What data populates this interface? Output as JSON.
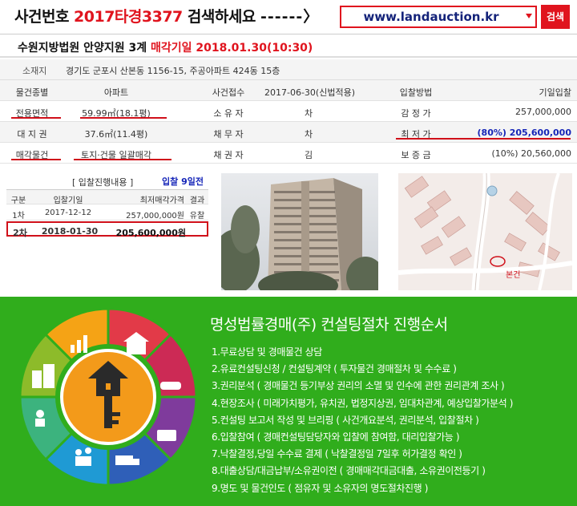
{
  "header": {
    "case_label": "사건번호",
    "case_number": "2017타경3377",
    "search_prompt": "검색하세요",
    "arrow": "------〉",
    "site_select": "www.landauction.kr",
    "search_button": "검색"
  },
  "court": {
    "info": "수원지방법원  안양지원  3계",
    "sale_date": "매각기일 2018.01.30(10:30)"
  },
  "address": {
    "label": "소재지",
    "value": "경기도 군포시 산본동 1156-15, 주공아파트 424동 15층"
  },
  "info_rows": [
    [
      "물건종별",
      "아파트",
      "사건접수",
      "2017-06-30(신법적용)",
      "입찰방법",
      "기일입찰"
    ],
    [
      "전용면적",
      "59.99㎡(18.1평)",
      "소 유 자",
      "차",
      "감 정 가",
      "257,000,000"
    ],
    [
      "대 지 권",
      "37.6㎡(11.4평)",
      "채 무 자",
      "차",
      "최 저 가",
      "(80%) 205,600,000"
    ],
    [
      "매각물건",
      "토지·건물 일괄매각",
      "채 권 자",
      "김",
      "보 증 금",
      "(10%) 20,560,000"
    ]
  ],
  "bid_history": {
    "title": "[ 입찰진행내용 ]",
    "days": "입찰 9일전",
    "headers": [
      "구분",
      "입찰기일",
      "최저매각가격",
      "결과"
    ],
    "rows": [
      [
        "1차",
        "2017-12-12",
        "257,000,000원",
        "유찰"
      ],
      [
        "2차",
        "2018-01-30",
        "205,600,000원",
        ""
      ]
    ]
  },
  "map": {
    "label": "본건"
  },
  "process": {
    "title": "명성법률경매(주) 컨설팅절차 진행순서",
    "steps": [
      "1.무료상담 및 경매물건 상담",
      "2.유료컨설팅신청 / 컨설팅계약 ( 투자물건 경매절차 및 수수료 )",
      "3.권리분석 ( 경매물건 등기부상 권리의 소멸 및 인수에 관한 권리관계 조사 )",
      "4.현장조사 ( 미래가치평가, 유치권, 법정지상권, 임대차관계, 예상입찰가분석 )",
      "5.컨설팅 보고서 작성 및 브리핑 ( 사건개요분석, 권리분석, 입찰절차 )",
      "6.입찰참여 ( 경매컨설팅담당자와 입찰에 참여함, 대리입찰가능 )",
      "7.낙찰결정,당일 수수료 결제 ( 낙찰결정일 7일후 허가결정 확인 )",
      "8.대출상담/대금납부/소유권이전 ( 경매매각대금대출, 소유권이전등기 )",
      "9.명도 및 물건인도 ( 점유자 및 소유자의 명도절차진행 )"
    ]
  },
  "colors": {
    "accent": "#e0141e",
    "blue": "#1525b8",
    "green": "#30ad1c"
  }
}
